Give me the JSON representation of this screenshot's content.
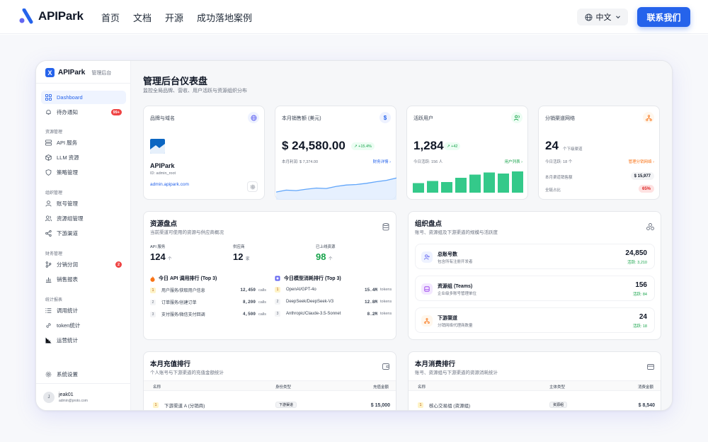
{
  "topnav": {
    "brand": "APIPark",
    "links": [
      "首页",
      "文档",
      "开源",
      "成功落地案例"
    ],
    "language": "中文",
    "contact_label": "联系我们"
  },
  "sidebar": {
    "brand": "APIPark",
    "subtitle": "管理后台",
    "dashboard": "Dashboard",
    "notifications": "待办通知",
    "notifications_badge": "99+",
    "sections": {
      "resources": "资源管理",
      "org": "组织管理",
      "finance": "财务管理",
      "stats": "统计报表"
    },
    "api_services": "API 服务",
    "llm_resources": "LLM 资源",
    "policy": "策略管理",
    "accounts": "账号管理",
    "resource_groups": "资源组管理",
    "downstream": "下游渠道",
    "distribution": "分销分润",
    "distribution_badge": "2",
    "sales_report": "销售报表",
    "call_stats": "调用统计",
    "token_stats": "token统计",
    "ops_stats": "运营统计",
    "settings": "系统设置",
    "user": {
      "initial": "J",
      "name": "jeak01",
      "email": "admin@proto.com"
    }
  },
  "main": {
    "title": "管理后台仪表盘",
    "subtitle": "监控全局品牌、营收、用户活跃与资源组织分布"
  },
  "brand_card": {
    "label": "品牌与域名",
    "name": "APIPark",
    "id": "ID: admin_root",
    "domain": "admin.apipark.com"
  },
  "sales_card": {
    "label": "本月销售额 (美元)",
    "value": "$ 24,580.00",
    "change": "↗ +15.4%",
    "profit": "本月利润: $ 7,374.00",
    "link": "财务详情 ›",
    "trend": [
      0.18,
      0.26,
      0.24,
      0.3,
      0.35,
      0.33,
      0.42,
      0.48,
      0.5,
      0.55,
      0.62,
      0.68,
      0.78
    ]
  },
  "users_card": {
    "label": "活跃用户",
    "value": "1,284",
    "change": "↗ +42",
    "today": "今日活跃: 156 人",
    "link": "用户列表 ›",
    "bars": [
      0.45,
      0.55,
      0.5,
      0.7,
      0.85,
      0.95,
      0.9,
      1.0
    ]
  },
  "channel_card": {
    "label": "分销渠道网络",
    "value": "24",
    "unit": "个下级渠道",
    "today": "今日活跃: 18 个",
    "link": "管理分销网络 ›",
    "sales_label": "本月渠道销售额",
    "sales_value": "$ 15,977",
    "share_label": "全链占比",
    "share_value": "65%"
  },
  "resources": {
    "title": "资源盘点",
    "subtitle": "当前渠道可使用的资源与供应商概况",
    "stats": [
      {
        "label": "API 服务",
        "value": "124",
        "unit": "个"
      },
      {
        "label": "供应商",
        "value": "12",
        "unit": "家"
      },
      {
        "label": "已上线资源",
        "value": "98",
        "unit": "个"
      }
    ],
    "api_rank_title": "今日 API 调用排行 (Top 3)",
    "api_rank": [
      {
        "n": "1",
        "name": "用户服务/获取用户信息",
        "value": "12,450",
        "unit": "calls"
      },
      {
        "n": "2",
        "name": "订单服务/创建订单",
        "value": "8,200",
        "unit": "calls"
      },
      {
        "n": "3",
        "name": "支付服务/微信支付回调",
        "value": "4,500",
        "unit": "calls"
      }
    ],
    "model_rank_title": "今日模型消耗排行 (Top 3)",
    "model_rank": [
      {
        "n": "1",
        "name": "OpenAI/GPT-4o",
        "value": "15.4M",
        "unit": "tokens"
      },
      {
        "n": "2",
        "name": "DeepSeek/DeepSeek-V3",
        "value": "12.8M",
        "unit": "tokens"
      },
      {
        "n": "3",
        "name": "Anthropic/Claude-3.5-Sonnet",
        "value": "8.2M",
        "unit": "tokens"
      }
    ]
  },
  "org": {
    "title": "组织盘点",
    "subtitle": "账号、资源组及下游渠道的规模与活跃度",
    "rows": [
      {
        "name": "总账号数",
        "desc": "包含所有注册开发者",
        "value": "24,850",
        "active": "活跃: 3,210"
      },
      {
        "name": "资源组 (Teams)",
        "desc": "企业级多账号管理单位",
        "value": "156",
        "active": "活跃: 84"
      },
      {
        "name": "下游渠道",
        "desc": "分销网络代理商数量",
        "value": "24",
        "active": "活跃: 18"
      }
    ]
  },
  "recharge": {
    "title": "本月充值排行",
    "subtitle": "个人账号与下游渠道的充值金额统计",
    "headers": [
      "名称",
      "身份类型",
      "充值金额"
    ],
    "rows": [
      {
        "n": "1",
        "name": "下游渠道 A (分销商)",
        "type": "下游渠道",
        "amount": "$ 15,000"
      }
    ]
  },
  "consume": {
    "title": "本月消费排行",
    "subtitle": "账号、资源组与下游渠道的资源消耗统计",
    "headers": [
      "名称",
      "主体类型",
      "消费金额"
    ],
    "rows": [
      {
        "n": "1",
        "name": "核心交易组 (资源组)",
        "type": "资源组",
        "amount": "$ 8,540"
      }
    ]
  },
  "colors": {
    "accent": "#2563eb",
    "green": "#34c98a",
    "orange": "#f97316"
  }
}
